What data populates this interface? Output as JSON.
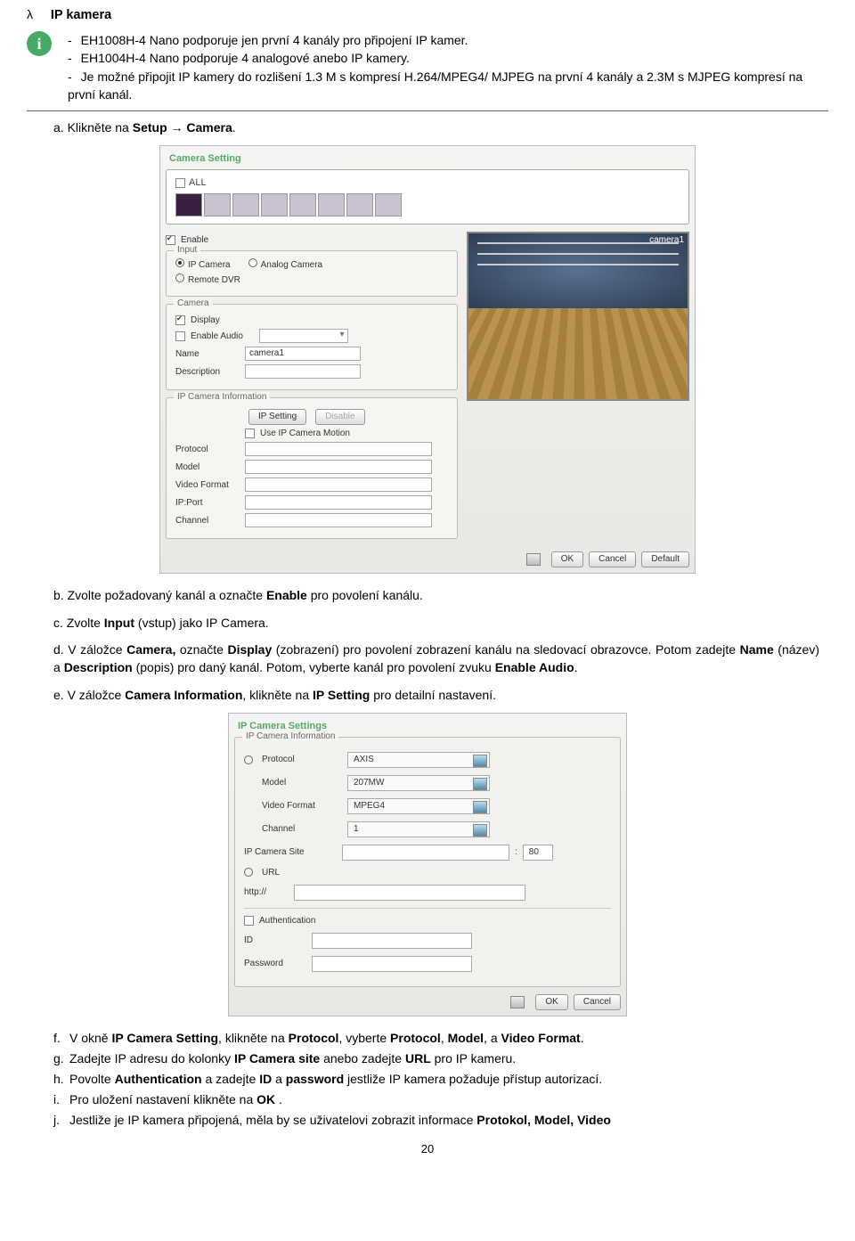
{
  "header": {
    "lambda": "λ",
    "title": "IP kamera"
  },
  "info": {
    "lines": [
      "EH1008H-4 Nano podporuje jen první 4 kanály pro připojení IP kamer.",
      "EH1004H-4 Nano podporuje 4 analogové anebo IP kamery.",
      "Je možné připojit IP kamery do rozlišení 1.3 M s kompresí H.264/MPEG4/ MJPEG na první 4 kanály a 2.3M s MJPEG kompresí na první kanál."
    ]
  },
  "steps_top": {
    "a_pre": "a. Klikněte na ",
    "a_b1": "Setup",
    "a_mid": " → ",
    "a_b2": "Camera",
    "a_post": "."
  },
  "shot1": {
    "title": "Camera Setting",
    "all": "ALL",
    "enable": "Enable",
    "input": {
      "title": "Input",
      "ipcam": "IP Camera",
      "anacam": "Analog Camera",
      "rdvr": "Remote DVR"
    },
    "camera": {
      "title": "Camera",
      "display": "Display",
      "enableAudio": "Enable Audio",
      "nameLabel": "Name",
      "nameVal": "camera1",
      "descLabel": "Description"
    },
    "camLabel": "camera1",
    "ipinfo": {
      "title": "IP Camera Information",
      "ipSetting": "IP Setting",
      "disable": "Disable",
      "useMotion": "Use IP Camera Motion",
      "protocol": "Protocol",
      "model": "Model",
      "video": "Video Format",
      "ipport": "IP:Port",
      "channel": "Channel"
    },
    "buttons": {
      "ok": "OK",
      "cancel": "Cancel",
      "default": "Default"
    }
  },
  "steps_mid": {
    "b": "b. Zvolte požadovaný kanál a označte Enable pro povolení kanálu.",
    "b_bold": "Enable",
    "c": "c. Zvolte Input (vstup) jako IP Camera.",
    "c_bold": "Input",
    "d_pre": "d. V záložce ",
    "d_b1": "Camera,",
    "d_mid1": " označte ",
    "d_b2": "Display",
    "d_mid2": " (zobrazení) pro povolení zobrazení kanálu na sledovací obrazovce. Potom zadejte ",
    "d_b3": "Name",
    "d_mid3": " (název) a ",
    "d_b4": "Description",
    "d_mid4": " (popis) pro daný kanál. Potom, vyberte kanál pro povolení zvuku ",
    "d_b5": "Enable Audio",
    "d_post": ".",
    "e_pre": "e. V záložce ",
    "e_b1": "Camera Information",
    "e_mid": ", klikněte na ",
    "e_b2": "IP Setting",
    "e_post": " pro detailní nastavení."
  },
  "shot2": {
    "title": "IP Camera Settings",
    "group": "IP Camera Information",
    "protocol_l": "Protocol",
    "protocol_v": "AXIS",
    "model_l": "Model",
    "model_v": "207MW",
    "video_l": "Video Format",
    "video_v": "MPEG4",
    "channel_l": "Channel",
    "channel_v": "1",
    "site_l": "IP Camera Site",
    "port_v": "80",
    "url_l": "URL",
    "http": "http://",
    "auth": "Authentication",
    "id": "ID",
    "pwd": "Password",
    "ok": "OK",
    "cancel": "Cancel"
  },
  "steps_bot": {
    "f": "V okně IP Camera Setting, klikněte na Protocol, vyberte Protocol, Model, a Video Format.",
    "g": "Zadejte IP adresu do kolonky IP Camera site anebo zadejte URL pro IP kameru.",
    "h": "Povolte Authentication a zadejte ID a password jestliže IP kamera požaduje přístup autorizací.",
    "i": "Pro uložení nastavení klikněte na OK .",
    "j": "Jestliže je IP kamera připojená, měla by se uživatelovi zobrazit informace Protokol, Model, Video"
  },
  "pageNum": "20"
}
